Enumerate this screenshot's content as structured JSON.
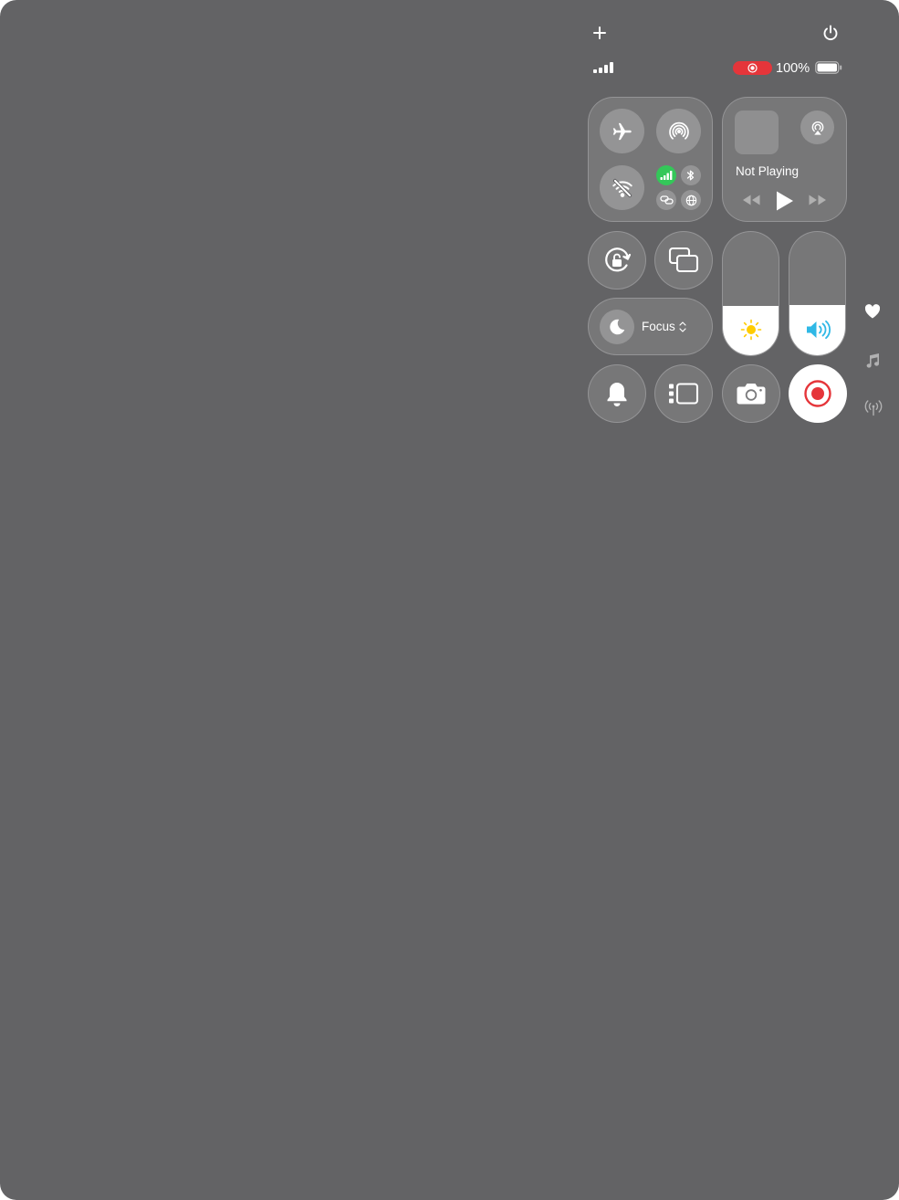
{
  "status_bar": {
    "battery_percent": "100%",
    "battery_level": 1.0,
    "cellular_bars": 4,
    "recording_indicator_color": "#e5353a"
  },
  "top_bar": {
    "add_icon": "plus-icon",
    "power_icon": "power-icon"
  },
  "connectivity": {
    "airplane_mode": "airplane-icon",
    "airdrop": "airdrop-icon",
    "wifi": "wifi-off-icon",
    "cellular": "cellular-icon",
    "bluetooth": "bluetooth-icon",
    "personal_hotspot": "link-icon",
    "vpn": "globe-icon",
    "cellular_active_color": "#34c759"
  },
  "now_playing": {
    "title": "Not Playing"
  },
  "focus": {
    "label": "Focus",
    "icon": "moon-icon"
  },
  "sliders": {
    "brightness_level": 0.4,
    "volume_level": 0.41,
    "brightness_icon_color": "#ffcc00",
    "volume_icon_color": "#2fb8e6"
  },
  "controls": {
    "orientation_lock": "rotation-lock-icon",
    "screen_mirroring": "screen-mirroring-icon",
    "silent_mode": "bell-icon",
    "stage_manager": "stage-manager-icon",
    "camera": "camera-icon",
    "screen_recording": "record-icon",
    "recording_color": "#e5353a"
  },
  "side_pages": [
    "heart-icon",
    "music-icon",
    "antenna-icon"
  ]
}
